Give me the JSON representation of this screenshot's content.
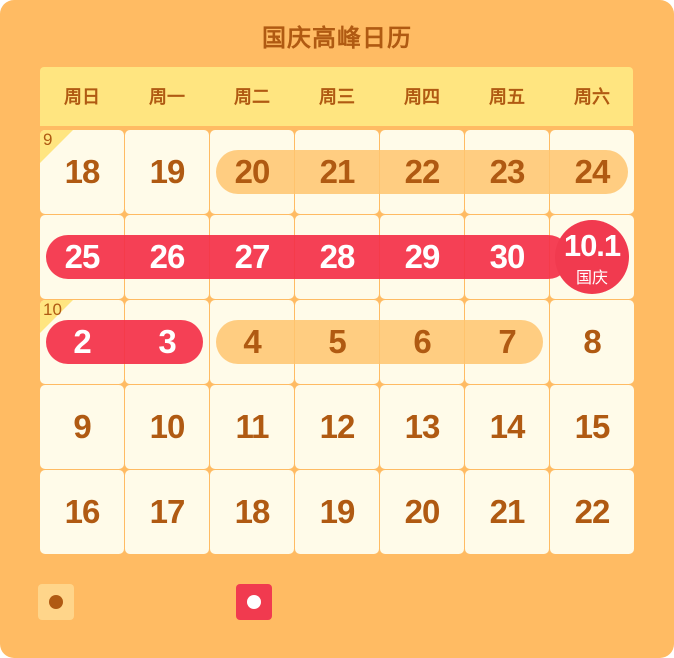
{
  "title": "国庆高峰日历",
  "colors": {
    "background": "#ffbb63",
    "header": "#ffe580",
    "cell": "#fffbe9",
    "text": "#b05a12",
    "holiday": "#f13a4f",
    "workday_band": "#ffc46e"
  },
  "weekdays": [
    "周日",
    "周一",
    "周二",
    "周三",
    "周四",
    "周五",
    "周六"
  ],
  "weeks": [
    [
      "18",
      "19",
      "20",
      "21",
      "22",
      "23",
      "24"
    ],
    [
      "25",
      "26",
      "27",
      "28",
      "29",
      "30",
      "10.1"
    ],
    [
      "2",
      "3",
      "4",
      "5",
      "6",
      "7",
      "8"
    ],
    [
      "9",
      "10",
      "11",
      "12",
      "13",
      "14",
      "15"
    ],
    [
      "16",
      "17",
      "18",
      "19",
      "20",
      "21",
      "22"
    ]
  ],
  "month_markers": [
    {
      "week": 0,
      "label": "9"
    },
    {
      "week": 2,
      "label": "10"
    }
  ],
  "national_day": {
    "date": "10.1",
    "label": "国庆"
  },
  "legend": [
    {
      "icon": "peak-dot-icon",
      "color": "#ffd58a",
      "dot": "#b05a12"
    },
    {
      "icon": "holiday-dot-icon",
      "color": "#f13a4f",
      "dot": "#ffffff"
    }
  ]
}
